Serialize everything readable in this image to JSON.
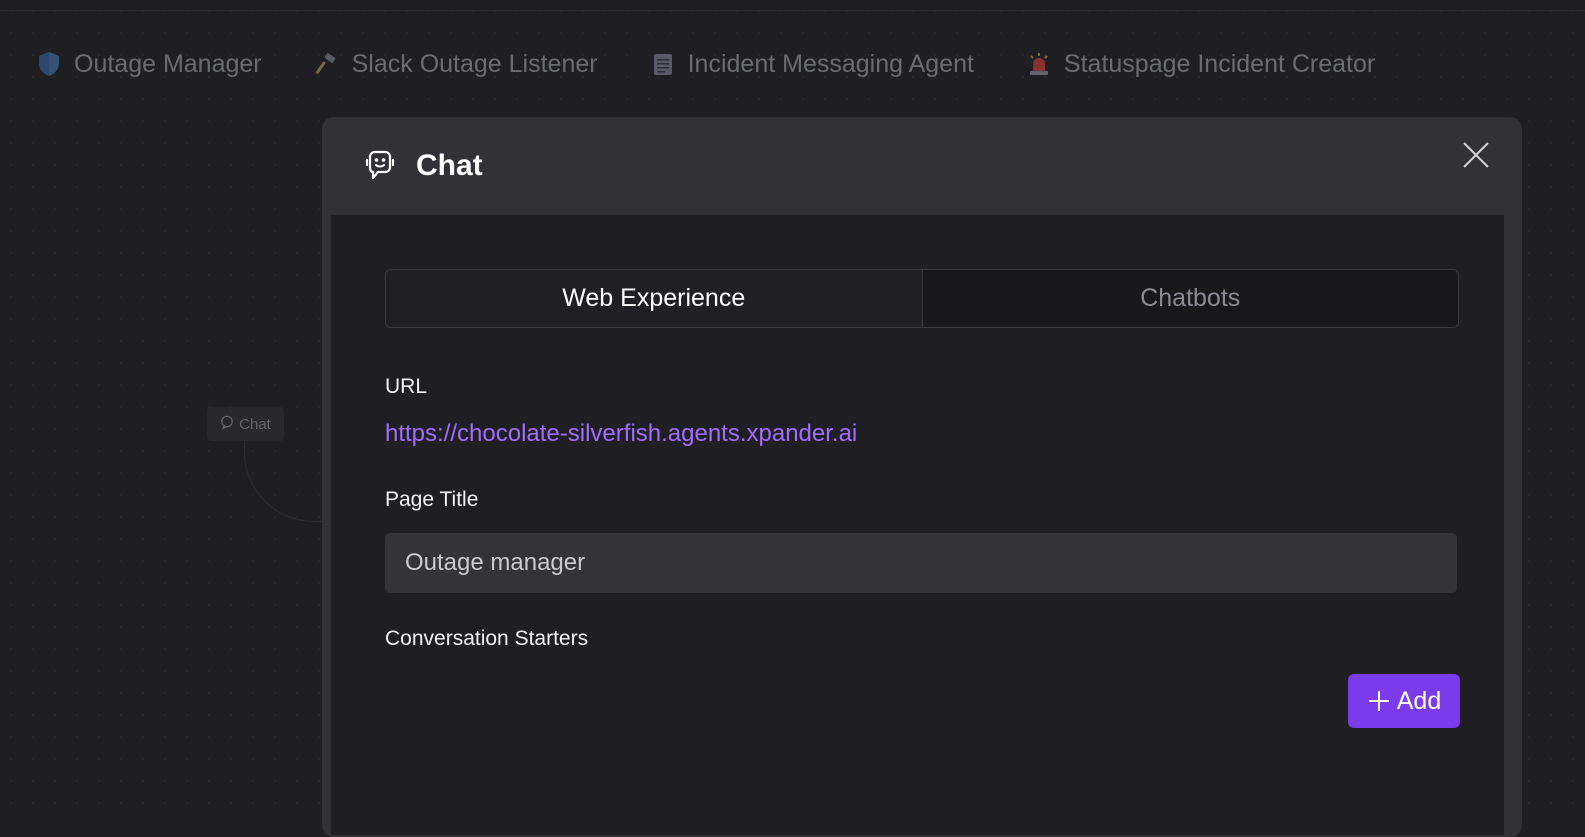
{
  "agents": [
    {
      "label": "Outage Manager",
      "icon": "shield-icon"
    },
    {
      "label": "Slack Outage Listener",
      "icon": "hammer-icon"
    },
    {
      "label": "Incident Messaging Agent",
      "icon": "notepad-icon"
    },
    {
      "label": "Statuspage Incident Creator",
      "icon": "siren-icon"
    }
  ],
  "canvas": {
    "node_label": "Chat"
  },
  "modal": {
    "title": "Chat",
    "tabs": [
      {
        "label": "Web Experience",
        "active": true
      },
      {
        "label": "Chatbots",
        "active": false
      }
    ],
    "url_label": "URL",
    "url_value": "https://chocolate-silverfish.agents.xpander.ai",
    "page_title_label": "Page Title",
    "page_title_value": "Outage manager",
    "conversation_starters_label": "Conversation Starters",
    "add_button_label": "Add"
  },
  "colors": {
    "accent": "#7c3aed",
    "link": "#a26cff",
    "background": "#1f1f23",
    "modal_header": "#313137"
  }
}
